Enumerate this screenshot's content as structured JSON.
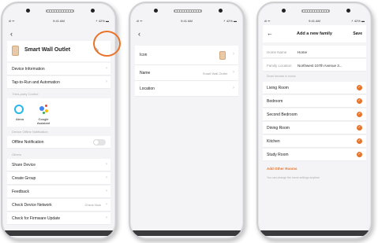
{
  "status": {
    "signal": "ıll ᯤ",
    "time": "9:41 AM",
    "battery": "⚡ 42% ▬"
  },
  "screen1": {
    "back_icon": "‹",
    "device_name": "Smart Wall Outlet",
    "edit_icon": "✎",
    "rows_top": [
      {
        "label": "Device Information"
      },
      {
        "label": "Tap-to-Run and Automation"
      }
    ],
    "section_third_party": "Third-party Control",
    "alexa_label": "Alexa",
    "google_label": "Google Assistant",
    "section_offline": "Device Offline Notification",
    "offline_label": "Offline Notification",
    "section_others": "Others",
    "rows_bottom": [
      {
        "label": "Share Device",
        "value": ""
      },
      {
        "label": "Create Group",
        "value": ""
      },
      {
        "label": "Feedback",
        "value": ""
      },
      {
        "label": "Check Device Network",
        "value": "Check Now"
      },
      {
        "label": "Check for Firmware Update",
        "value": ""
      }
    ],
    "colors": {
      "ring": "#e8742a",
      "alexa": "#27b7e8"
    }
  },
  "screen2": {
    "back_icon": "‹",
    "icon_label": "Icon",
    "name_label": "Name",
    "name_value": "Smart Wall Outlet",
    "location_label": "Location"
  },
  "screen3": {
    "back_icon": "←",
    "title": "Add a new family",
    "save_label": "Save",
    "home_name_key": "Home Name",
    "home_name_value": "Home",
    "family_location_key": "Family Location",
    "family_location_value": "Northwest 107th Avenue 3...",
    "rooms_header": "Smart devices in rooms",
    "rooms": [
      "Living Room",
      "Bedroom",
      "Second Bedroom",
      "Dining Room",
      "Kitchen",
      "Study Room"
    ],
    "add_rooms": "Add Other Rooms",
    "hint": "You can change the home settings anytime",
    "accent": "#e8742a"
  },
  "chevron": "›",
  "check_mark": "✓"
}
